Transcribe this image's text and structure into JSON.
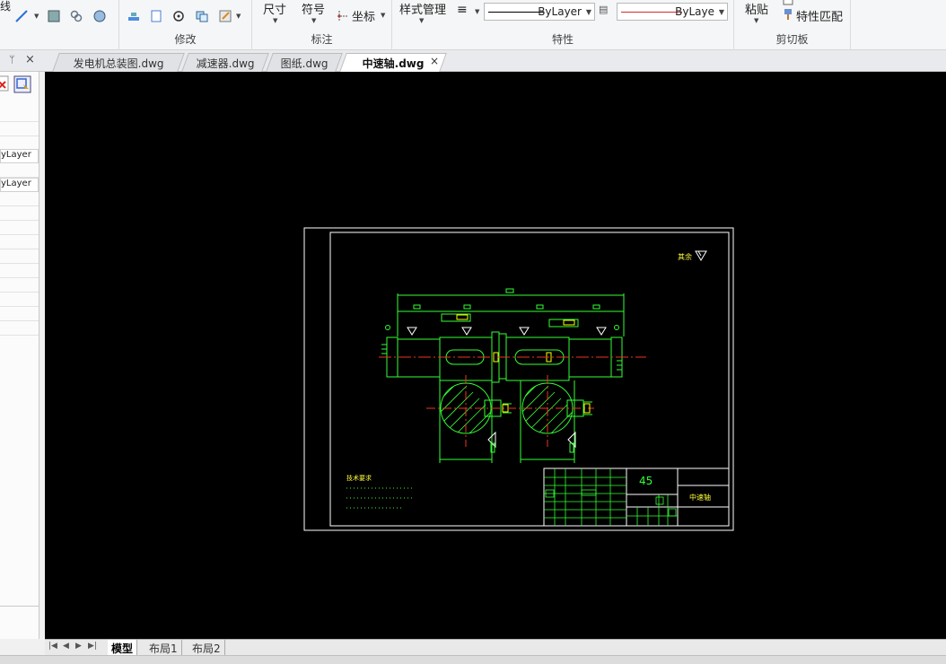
{
  "ribbon": {
    "modify_group_label": "修改",
    "annotate_group_label": "标注",
    "properties_group_label": "特性",
    "clipboard_group_label": "剪切板",
    "dimension_label": "尺寸",
    "symbol_label": "符号",
    "coordinate_label": "坐标",
    "style_manager_label": "样式管理",
    "bylayer_line_combo": "ByLayer",
    "bylayer_color_combo": "ByLaye",
    "paste_label": "粘贴",
    "match_properties_label": "特性匹配",
    "partial_left_text": "线"
  },
  "file_tabs": [
    {
      "label": "发电机总装图.dwg"
    },
    {
      "label": "减速器.dwg"
    },
    {
      "label": "图纸.dwg"
    },
    {
      "label": "中速轴.dwg"
    }
  ],
  "active_tab_close": "×",
  "left_panel": {
    "pin_icon": "pin-icon",
    "close_icon": "×",
    "rows": [
      "yLayer",
      "yLayer"
    ]
  },
  "drawing": {
    "material": "45",
    "part_name": "中速轴",
    "roughness_note": "其余",
    "requirements_title": "技术要求"
  },
  "layout_tabs": [
    {
      "label": "模型"
    },
    {
      "label": "布局1"
    },
    {
      "label": "布局2"
    }
  ]
}
